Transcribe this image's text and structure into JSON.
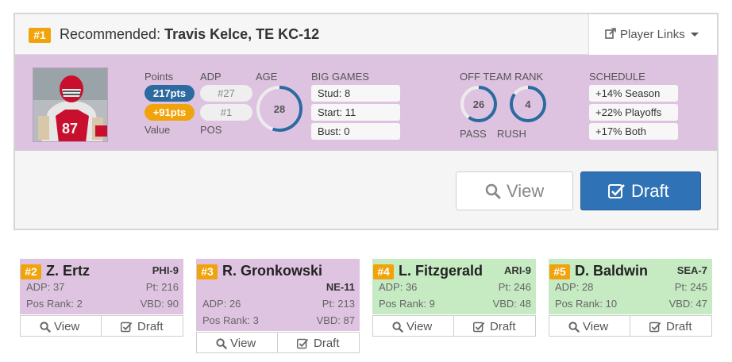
{
  "recommended": {
    "rank": "#1",
    "prefix": "Recommended:",
    "player": "Travis Kelce, TE KC-12",
    "player_links_label": "Player Links",
    "stats": {
      "points_label": "Points",
      "points_value": "217pts",
      "value_value": "+91pts",
      "value_label": "Value",
      "adp_label": "ADP",
      "adp_value": "#27",
      "pos_value": "#1",
      "pos_label": "POS",
      "age_label": "AGE",
      "age_value": "28",
      "big_games_label": "BIG GAMES",
      "big_games": [
        "Stud: 8",
        "Start: 11",
        "Bust: 0"
      ],
      "off_team_rank_label": "OFF TEAM RANK",
      "pass_rank": "26",
      "rush_rank": "4",
      "pass_label": "PASS",
      "rush_label": "RUSH",
      "schedule_label": "SCHEDULE",
      "schedule": [
        "+14% Season",
        "+22% Playoffs",
        "+17% Both"
      ]
    },
    "view_label": "View",
    "draft_label": "Draft"
  },
  "cards": [
    {
      "rank": "#2",
      "name": "Z. Ertz",
      "team": "PHI-9",
      "adp": "ADP: 37",
      "pt": "Pt: 216",
      "pos_rank": "Pos Rank: 2",
      "vbd": "VBD: 90",
      "view": "View",
      "draft": "Draft"
    },
    {
      "rank": "#3",
      "name": "R. Gronkowski",
      "team": "NE-11",
      "adp": "ADP: 26",
      "pt": "Pt: 213",
      "pos_rank": "Pos Rank: 3",
      "vbd": "VBD: 87",
      "view": "View",
      "draft": "Draft"
    },
    {
      "rank": "#4",
      "name": "L. Fitzgerald",
      "team": "ARI-9",
      "adp": "ADP: 36",
      "pt": "Pt: 246",
      "pos_rank": "Pos Rank: 9",
      "vbd": "VBD: 48",
      "view": "View",
      "draft": "Draft"
    },
    {
      "rank": "#5",
      "name": "D. Baldwin",
      "team": "SEA-7",
      "adp": "ADP: 28",
      "pt": "Pt: 245",
      "pos_rank": "Pos Rank: 10",
      "vbd": "VBD: 47",
      "view": "View",
      "draft": "Draft"
    }
  ],
  "colors": {
    "badge": "#f0a30a",
    "points_pill": "#2c6aa0",
    "value_pill": "#f0a30a",
    "stats_band": "#dec3e1",
    "draft_button": "#2f72b5",
    "te_card": "#dfc4e1",
    "wr_card": "#c6eac2"
  },
  "icons": {
    "player_links": "external-link-icon",
    "dropdown": "caret-down-icon",
    "view": "search-icon",
    "draft": "check-square-icon"
  },
  "rings": {
    "age_fraction": 0.55,
    "pass_fraction": 0.6,
    "rush_fraction": 0.85
  }
}
